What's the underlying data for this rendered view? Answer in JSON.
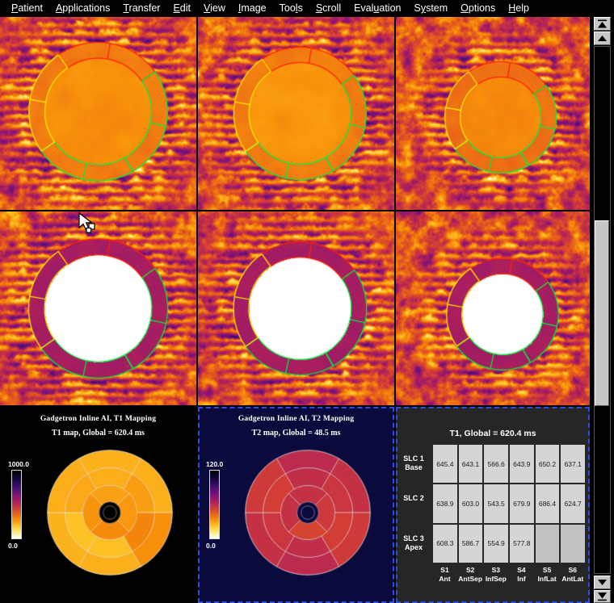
{
  "menu": {
    "items": [
      {
        "label": "Patient",
        "accel": "P"
      },
      {
        "label": "Applications",
        "accel": "A"
      },
      {
        "label": "Transfer",
        "accel": "T"
      },
      {
        "label": "Edit",
        "accel": "E"
      },
      {
        "label": "View",
        "accel": "V"
      },
      {
        "label": "Image",
        "accel": "I"
      },
      {
        "label": "Tools",
        "accel": "l"
      },
      {
        "label": "Scroll",
        "accel": "S"
      },
      {
        "label": "Evaluation",
        "accel": "u"
      },
      {
        "label": "System",
        "accel": "y"
      },
      {
        "label": "Options",
        "accel": "O"
      },
      {
        "label": "Help",
        "accel": "H"
      }
    ]
  },
  "images": {
    "row1_label": "T1 map short-axis slices",
    "row2_label": "T2 map short-axis slices",
    "contour_colors": {
      "epi_anterior": "#ff2a00",
      "endo_septal": "#ffe600",
      "lateral": "#00e83c"
    }
  },
  "t1_panel": {
    "title": "Gadgetron Inline AI, T1 Mapping",
    "subtitle": "T1 map, Global = 620.4 ms",
    "colorbar_max": "1000.0",
    "colorbar_min": "0.0",
    "background": "#000000"
  },
  "t2_panel": {
    "title": "Gadgetron Inline AI, T2 Mapping",
    "subtitle": "T2 map, Global = 48.5 ms",
    "colorbar_max": "120.0",
    "colorbar_min": "0.0",
    "background": "#0a0a3c"
  },
  "table_panel": {
    "title": "T1, Global = 620.4 ms",
    "row_labels": [
      {
        "line1": "SLC 1",
        "line2": "Base"
      },
      {
        "line1": "SLC 2",
        "line2": ""
      },
      {
        "line1": "SLC 3",
        "line2": "Apex"
      }
    ],
    "col_labels": [
      {
        "line1": "S1",
        "line2": "Ant"
      },
      {
        "line1": "S2",
        "line2": "AntSep"
      },
      {
        "line1": "S3",
        "line2": "InfSep"
      },
      {
        "line1": "S4",
        "line2": "Inf"
      },
      {
        "line1": "S5",
        "line2": "InfLat"
      },
      {
        "line1": "S6",
        "line2": "AntLat"
      }
    ],
    "rows": [
      [
        "645.4",
        "643.1",
        "566.6",
        "643.9",
        "650.2",
        "637.1"
      ],
      [
        "638.9",
        "603.0",
        "543.5",
        "679.9",
        "686.4",
        "624.7"
      ],
      [
        "608.3",
        "586.7",
        "554.9",
        "577.8",
        "",
        ""
      ]
    ]
  },
  "chart_data": [
    {
      "type": "pie",
      "name": "t1-bullseye",
      "title": "Gadgetron Inline AI, T1 Mapping",
      "subtitle": "T1 map, Global = 620.4 ms",
      "colormap": "inferno-like",
      "vmin": 0.0,
      "vmax": 1000.0,
      "rings": [
        {
          "name": "Base (SLC 1)",
          "segments": [
            "S1 Ant",
            "S2 AntSep",
            "S3 InfSep",
            "S4 Inf",
            "S5 InfLat",
            "S6 AntLat"
          ],
          "values": [
            645.4,
            643.1,
            566.6,
            643.9,
            650.2,
            637.1
          ]
        },
        {
          "name": "Mid (SLC 2)",
          "segments": [
            "S1 Ant",
            "S2 AntSep",
            "S3 InfSep",
            "S4 Inf",
            "S5 InfLat",
            "S6 AntLat"
          ],
          "values": [
            638.9,
            603.0,
            543.5,
            679.9,
            686.4,
            624.7
          ]
        },
        {
          "name": "Apex (SLC 3)",
          "segments": [
            "S1 Ant",
            "S2 AntSep",
            "S3 InfSep",
            "S4 Inf"
          ],
          "values": [
            608.3,
            586.7,
            554.9,
            577.8
          ]
        }
      ],
      "global_value": 620.4,
      "units": "ms"
    },
    {
      "type": "pie",
      "name": "t2-bullseye",
      "title": "Gadgetron Inline AI, T2 Mapping",
      "subtitle": "T2 map, Global = 48.5 ms",
      "colormap": "inferno-like",
      "vmin": 0.0,
      "vmax": 120.0,
      "global_value": 48.5,
      "units": "ms"
    },
    {
      "type": "table",
      "name": "t1-segment-table",
      "title": "T1, Global = 620.4 ms",
      "columns": [
        "S1 Ant",
        "S2 AntSep",
        "S3 InfSep",
        "S4 Inf",
        "S5 InfLat",
        "S6 AntLat"
      ],
      "index": [
        "SLC 1 Base",
        "SLC 2",
        "SLC 3 Apex"
      ],
      "values": [
        [
          645.4,
          643.1,
          566.6,
          643.9,
          650.2,
          637.1
        ],
        [
          638.9,
          603.0,
          543.5,
          679.9,
          686.4,
          624.7
        ],
        [
          608.3,
          586.7,
          554.9,
          577.8,
          null,
          null
        ]
      ],
      "units": "ms"
    }
  ],
  "scrollbar": {
    "top_end_icon": "double-up-arrow-icon",
    "up_icon": "up-arrow-icon",
    "down_icon": "down-arrow-icon",
    "bottom_end_icon": "double-down-arrow-icon"
  }
}
